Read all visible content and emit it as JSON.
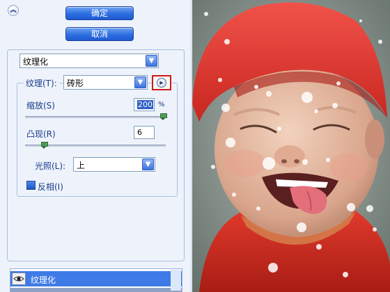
{
  "buttons": {
    "ok": "确定",
    "cancel": "取消"
  },
  "filter": {
    "selected": "纹理化"
  },
  "texture": {
    "label": "纹理(T):",
    "value": "砖形",
    "scale_label": "缩放(S)",
    "scale_value": "200",
    "scale_unit": "%",
    "scale_fraction": 1.0,
    "relief_label": "凸现(R)",
    "relief_value": "6",
    "relief_fraction": 0.12,
    "light_label": "光照(L):",
    "light_value": "上",
    "invert_label": "反相(I)",
    "invert_checked": true
  },
  "layers": {
    "active": "纹理化"
  },
  "icons": {
    "collapse": "chevron-double-up-icon",
    "texture_menu": "play-arrow-icon",
    "visibility": "eye-icon"
  },
  "colors": {
    "panel_bg": "#eef3fb",
    "accent_blue": "#2c6ee0",
    "label_blue": "#1a3a8a",
    "highlight_red": "#d01818",
    "cap_red": "#e03a2e"
  }
}
